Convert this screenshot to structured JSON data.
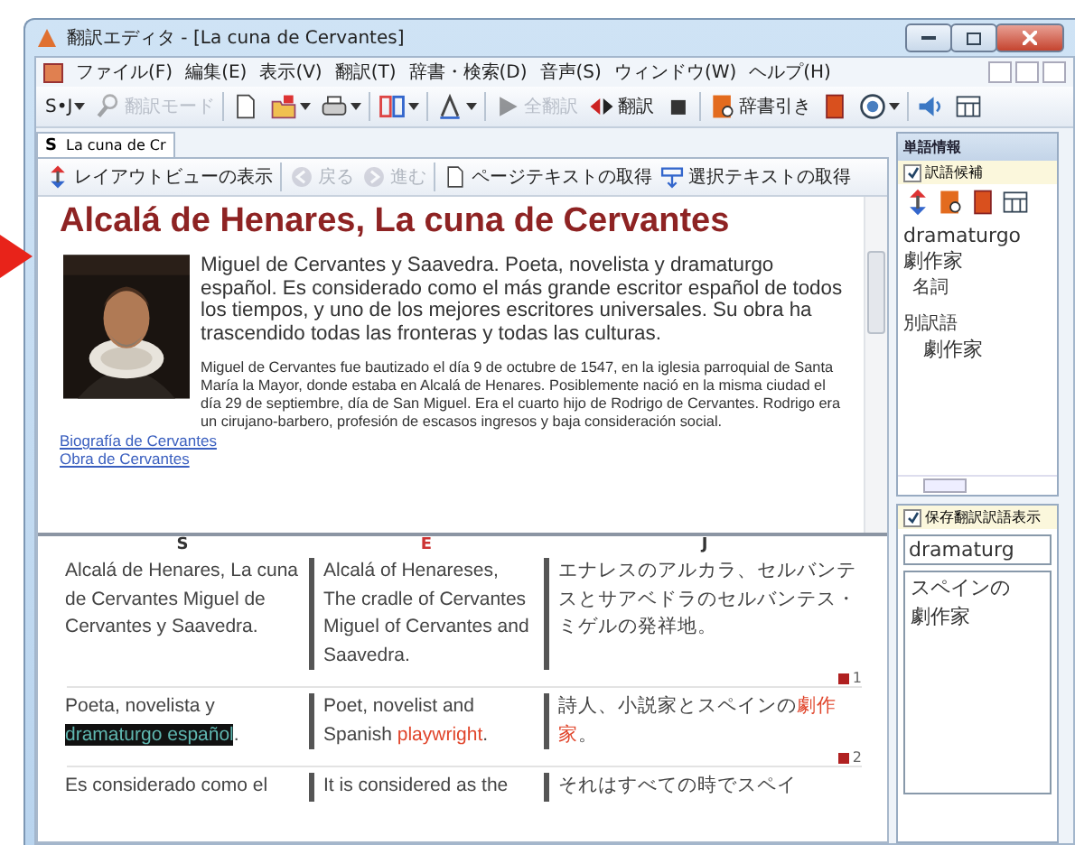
{
  "window": {
    "title": "翻訳エディタ - [La cuna de Cervantes]"
  },
  "menu": [
    "ファイル(F)",
    "編集(E)",
    "表示(V)",
    "翻訳(T)",
    "辞書・検索(D)",
    "音声(S)",
    "ウィンドウ(W)",
    "ヘルプ(H)"
  ],
  "toolbar": [
    {
      "label": "S•J",
      "disabled": false
    },
    {
      "label": "翻訳モード",
      "disabled": true
    },
    {
      "disabled": false
    },
    {
      "disabled": false
    },
    {
      "disabled": false
    },
    {
      "disabled": false
    },
    {
      "disabled": false
    },
    {
      "label": "全翻訳",
      "disabled": true
    },
    {
      "label": "翻訳",
      "disabled": false
    },
    {
      "disabled": false
    },
    {
      "label": "辞書引き",
      "disabled": false
    },
    {
      "disabled": false
    },
    {
      "disabled": false
    },
    {
      "disabled": false
    },
    {
      "disabled": false
    }
  ],
  "tabs": [
    {
      "label": "S",
      "title": "La cuna de Cr",
      "selected": true
    }
  ],
  "view_toolbar": [
    {
      "label": "レイアウトビューの表示",
      "disabled": false
    },
    {
      "label": "戻る",
      "disabled": true
    },
    {
      "label": "進む",
      "disabled": true
    },
    {
      "label": "ページテキストの取得",
      "disabled": false
    },
    {
      "label": "選択テキストの取得",
      "disabled": false
    }
  ],
  "document": {
    "heading": "Alcalá de Henares, La cuna de Cervantes",
    "intro": "Miguel de Cervantes y Saavedra.  Poeta, novelista y dramaturgo español.  Es considerado como el más grande escritor español de todos los tiempos, y uno de los mejores escritores universales. Su obra ha trascendido todas las fronteras y todas las culturas.",
    "body": "Miguel de Cervantes fue bautizado el día 9 de octubre de 1547, en la iglesia parroquial de Santa María la Mayor, donde estaba en Alcalá de Henares.  Posiblemente nació en la misma ciudad el día 29 de septiembre, día de San Miguel.  Era el cuarto hijo de Rodrigo de Cervantes.  Rodrigo era un cirujano-barbero, profesión de escasos ingresos y baja consideración social.",
    "links": [
      "Biografía de Cervantes",
      "Obra de Cervantes"
    ]
  },
  "grid": {
    "columns": [
      "S",
      "E",
      "J"
    ],
    "rows": [
      {
        "number": "1",
        "cells": [
          [
            {
              "kind": "plain",
              "text": "Alcalá de Henares, La cuna de Cervantes  Miguel de Cervantes y Saavedra."
            }
          ],
          [
            {
              "kind": "plain",
              "text": "Alcalá of Henareses, The cradle of Cervantes Miguel of Cervantes and Saavedra."
            }
          ],
          [
            {
              "kind": "plain",
              "text": "エナレスのアルカラ、セルバンテスとサアベドラのセルバンテス・ミゲルの発祥地。"
            }
          ]
        ]
      },
      {
        "number": "2",
        "cells": [
          [
            {
              "kind": "plain",
              "text": "Poeta, novelista y "
            },
            {
              "kind": "selected",
              "text": "dramaturgo español"
            },
            {
              "kind": "plain",
              "text": "."
            }
          ],
          [
            {
              "kind": "plain",
              "text": "Poet, novelist and Spanish "
            },
            {
              "kind": "term",
              "text": "playwright"
            },
            {
              "kind": "plain",
              "text": "."
            }
          ],
          [
            {
              "kind": "plain",
              "text": "詩人、小説家とスペインの"
            },
            {
              "kind": "term",
              "text": "劇作家"
            },
            {
              "kind": "plain",
              "text": "。"
            }
          ]
        ]
      },
      {
        "cells": [
          [
            {
              "kind": "plain",
              "text": "Es considerado como el"
            }
          ],
          [
            {
              "kind": "plain",
              "text": "It is considered as the"
            }
          ],
          [
            {
              "kind": "plain",
              "text": "それはすべての時でスペイ"
            }
          ]
        ]
      }
    ]
  },
  "word_info": {
    "title": "単語情報",
    "option": {
      "label": "訳語候補",
      "checked": true
    },
    "word": "dramaturgo",
    "translation": "劇作家",
    "part_of_speech": "名詞",
    "alt_label": "別訳語",
    "alternatives": [
      "劇作家"
    ]
  },
  "saved_info": {
    "option": {
      "label": "保存翻訳訳語表示",
      "checked": true
    },
    "word": "dramaturg",
    "translation": "スペインの劇作家"
  }
}
